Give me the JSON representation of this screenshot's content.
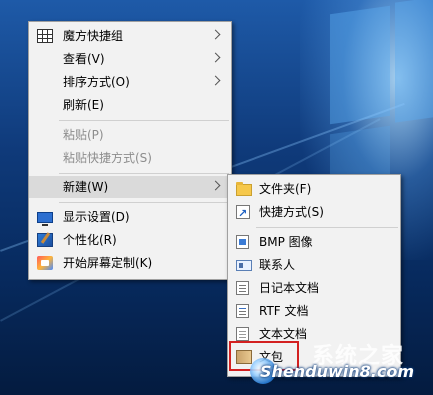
{
  "main_menu": {
    "items": [
      {
        "label": "魔方快捷组",
        "icon": "grid-icon",
        "submenu": true
      },
      {
        "label": "查看(V)",
        "submenu": true
      },
      {
        "label": "排序方式(O)",
        "submenu": true
      },
      {
        "label": "刷新(E)"
      },
      {
        "label": "粘贴(P)",
        "disabled": true
      },
      {
        "label": "粘贴快捷方式(S)",
        "disabled": true
      },
      {
        "label": "新建(W)",
        "submenu": true,
        "selected": true
      },
      {
        "label": "显示设置(D)",
        "icon": "display-settings-icon"
      },
      {
        "label": "个性化(R)",
        "icon": "personalize-icon"
      },
      {
        "label": "开始屏幕定制(K)",
        "icon": "start-screen-icon"
      }
    ]
  },
  "new_submenu": {
    "items": [
      {
        "label": "文件夹(F)",
        "icon": "folder-icon"
      },
      {
        "label": "快捷方式(S)",
        "icon": "shortcut-icon"
      },
      {
        "label": "BMP 图像",
        "icon": "bmp-image-icon"
      },
      {
        "label": "联系人",
        "icon": "contact-icon"
      },
      {
        "label": "日记本文档",
        "icon": "journal-document-icon"
      },
      {
        "label": "RTF 文档",
        "icon": "rtf-document-icon"
      },
      {
        "label": "文本文档",
        "icon": "text-document-icon"
      },
      {
        "label": "文包",
        "icon": "archive-icon"
      }
    ]
  },
  "highlight_color": "#d32020",
  "watermark": {
    "text_cn": "系统之家",
    "text_en": "Shenduwin8.com"
  }
}
